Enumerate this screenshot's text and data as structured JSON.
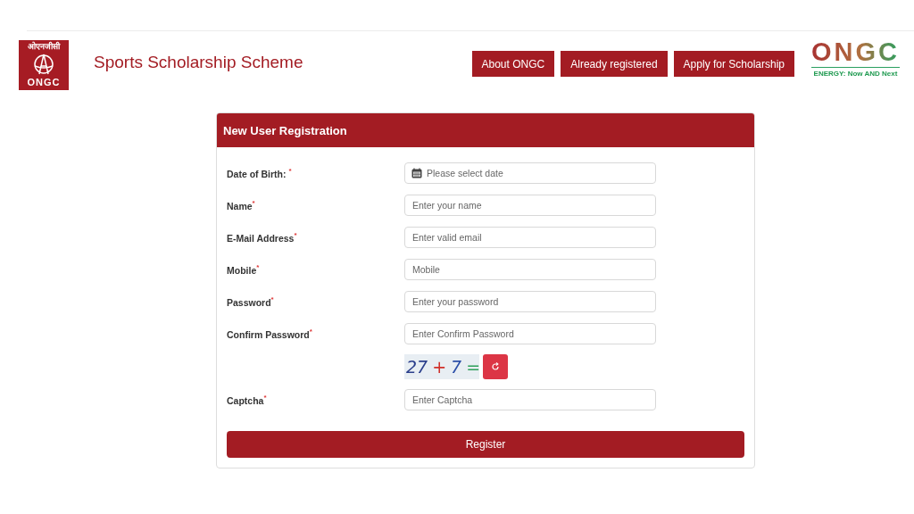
{
  "header": {
    "logo": {
      "hindi": "ओएनजीसी",
      "text": "ONGC"
    },
    "title": "Sports Scholarship Scheme",
    "nav": [
      "About ONGC",
      "Already registered",
      "Apply for Scholarship"
    ],
    "brand": {
      "name": "ONGC",
      "tagline": "ENERGY: Now AND Next"
    }
  },
  "form": {
    "title": "New User Registration",
    "fields": [
      {
        "kind": "date",
        "label": "Date of Birth: $^{*}$",
        "placeholder": "Please select date"
      },
      {
        "kind": "text",
        "label": "Name$^{*}$",
        "placeholder": "Enter your name"
      },
      {
        "kind": "text",
        "label": "E-Mail Address$^{*}$",
        "placeholder": "Enter valid email"
      },
      {
        "kind": "text",
        "label": "Mobile$^{*}$",
        "placeholder": "Mobile"
      },
      {
        "kind": "text",
        "label": "Password$^{*}$",
        "placeholder": "Enter your password"
      },
      {
        "kind": "text",
        "label": "Confirm Password$^{*}$",
        "placeholder": "Enter Confirm Password"
      }
    ],
    "captcha": {
      "parts": [
        {
          "text": "27",
          "color": "#2b3f8c"
        },
        {
          "text": "+",
          "color": "#d0302a"
        },
        {
          "text": "7",
          "color": "#2b4fa8"
        },
        {
          "text": "=",
          "color": "#2fa05a"
        }
      ]
    },
    "captcha_field": {
      "label": "Captcha$^{*}$",
      "placeholder": "Enter Captcha"
    },
    "submit": "Register"
  }
}
